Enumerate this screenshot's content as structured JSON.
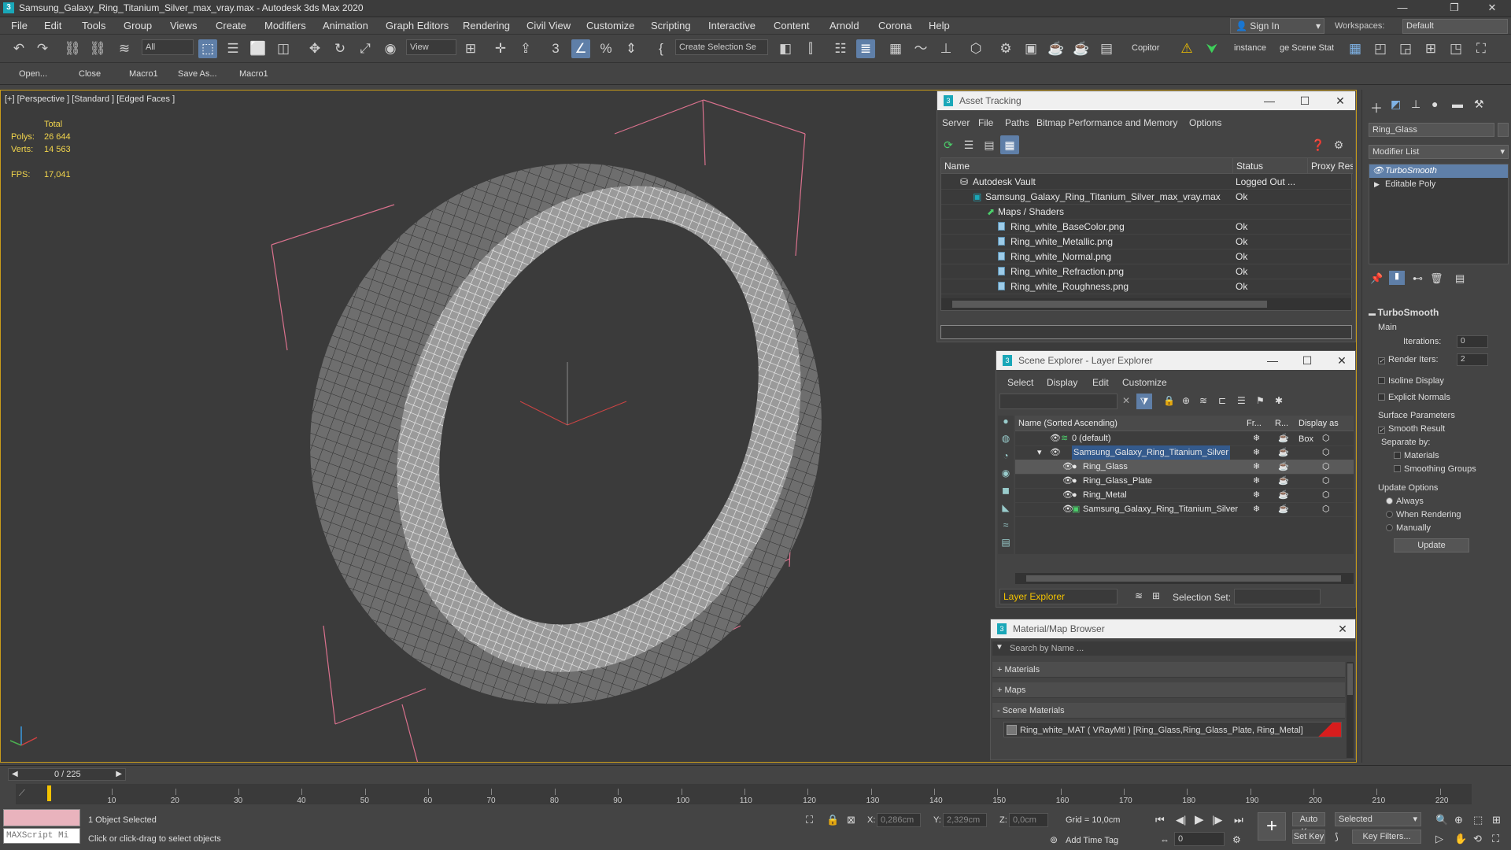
{
  "app": {
    "title": "Samsung_Galaxy_Ring_Titanium_Silver_max_vray.max - Autodesk 3ds Max 2020",
    "icon": "3"
  },
  "menu": [
    "File",
    "Edit",
    "Tools",
    "Group",
    "Views",
    "Create",
    "Modifiers",
    "Animation",
    "Graph Editors",
    "Rendering",
    "Civil View",
    "Customize",
    "Scripting",
    "Interactive",
    "Content",
    "Arnold",
    "Corona",
    "Help"
  ],
  "signin": {
    "label": "Sign In"
  },
  "workspace": {
    "label": "Workspaces:",
    "value": "Default"
  },
  "toolbar": {
    "selection_filter": "All",
    "ref_coord": "View",
    "named_selection": "Create Selection Se",
    "copitor": "Copitor",
    "instance": "instance",
    "scene_states": "ge Scene Stat"
  },
  "shelf": [
    "Open...",
    "Close",
    "Macro1",
    "Save As...",
    "Macro1"
  ],
  "viewport": {
    "label": "[+] [Perspective ] [Standard ] [Edged Faces ]",
    "stats_header": "Total",
    "polys_label": "Polys:",
    "polys": "26 644",
    "verts_label": "Verts:",
    "verts": "14 563",
    "fps_label": "FPS:",
    "fps": "17,041"
  },
  "asset_tracking": {
    "title": "Asset Tracking",
    "menu": [
      "Server",
      "File",
      "Paths",
      "Bitmap Performance and Memory",
      "Options"
    ],
    "columns": [
      "Name",
      "Status",
      "Proxy Res"
    ],
    "rows": [
      {
        "name": "Autodesk Vault",
        "status": "Logged Out ..."
      },
      {
        "name": "Samsung_Galaxy_Ring_Titanium_Silver_max_vray.max",
        "status": "Ok"
      },
      {
        "name": "Maps / Shaders",
        "status": ""
      },
      {
        "name": "Ring_white_BaseColor.png",
        "status": "Ok"
      },
      {
        "name": "Ring_white_Metallic.png",
        "status": "Ok"
      },
      {
        "name": "Ring_white_Normal.png",
        "status": "Ok"
      },
      {
        "name": "Ring_white_Refraction.png",
        "status": "Ok"
      },
      {
        "name": "Ring_white_Roughness.png",
        "status": "Ok"
      }
    ]
  },
  "scene_explorer": {
    "title": "Scene Explorer - Layer Explorer",
    "menu": [
      "Select",
      "Display",
      "Edit",
      "Customize"
    ],
    "columns": [
      "Name (Sorted Ascending)",
      "Fr...",
      "R...",
      "Display as Box"
    ],
    "rows": [
      {
        "name": "0 (default)"
      },
      {
        "name": "Samsung_Galaxy_Ring_Titanium_Silver"
      },
      {
        "name": "Ring_Glass"
      },
      {
        "name": "Ring_Glass_Plate"
      },
      {
        "name": "Ring_Metal"
      },
      {
        "name": "Samsung_Galaxy_Ring_Titanium_Silver"
      }
    ],
    "footer_dropdown": "Layer Explorer",
    "selection_set_label": "Selection Set:"
  },
  "material_browser": {
    "title": "Material/Map Browser",
    "search_placeholder": "Search by Name ...",
    "groups": [
      "+ Materials",
      "+ Maps",
      "- Scene Materials"
    ],
    "material": "Ring_white_MAT  ( VRayMtl )  [Ring_Glass,Ring_Glass_Plate, Ring_Metal]"
  },
  "command_panel": {
    "object_name": "Ring_Glass",
    "modifier_list": "Modifier List",
    "stack": [
      "TurboSmooth",
      "Editable Poly"
    ],
    "rollout": "TurboSmooth",
    "main": "Main",
    "iterations_label": "Iterations:",
    "iterations": "0",
    "render_iters_label": "Render Iters:",
    "render_iters": "2",
    "isoline": "Isoline Display",
    "explicit_normals": "Explicit Normals",
    "surface_params": "Surface Parameters",
    "smooth_result": "Smooth Result",
    "separate_by": "Separate by:",
    "materials": "Materials",
    "smoothing_groups": "Smoothing Groups",
    "update_options": "Update Options",
    "always": "Always",
    "when_rendering": "When Rendering",
    "manually": "Manually",
    "update_button": "Update"
  },
  "timeline": {
    "frame": "0 / 225",
    "ticks": [
      "10",
      "20",
      "30",
      "40",
      "50",
      "60",
      "70",
      "80",
      "90",
      "100",
      "110",
      "120",
      "130",
      "140",
      "150",
      "160",
      "170",
      "180",
      "190",
      "200",
      "210",
      "220"
    ]
  },
  "status": {
    "maxscript": "MAXScript Mi",
    "selected": "1 Object Selected",
    "prompt": "Click or click-drag to select objects",
    "x_label": "X:",
    "x": "0,286cm",
    "y_label": "Y:",
    "y": "2,329cm",
    "z_label": "Z:",
    "z": "0,0cm",
    "grid": "Grid = 10,0cm",
    "add_time_tag": "Add Time Tag",
    "auto_key": "Auto Key",
    "set_key": "Set Key",
    "selected_dropdown": "Selected",
    "key_filters": "Key Filters...",
    "frame_field": "0"
  }
}
